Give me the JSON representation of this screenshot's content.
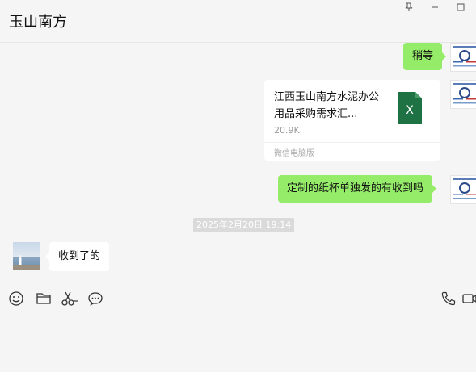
{
  "header": {
    "title": "玉山南方",
    "pin_icon": "pin-icon",
    "minimize_icon": "minimize-icon",
    "maximize_icon": "maximize-icon"
  },
  "messages": {
    "msg1": {
      "text": "稍等",
      "side": "right"
    },
    "file": {
      "name": "江西玉山南方水泥办公用品采购需求汇...",
      "size": "20.9K",
      "source": "微信电脑版",
      "icon": "excel-file-icon",
      "icon_letter": "X"
    },
    "msg3": {
      "text": "定制的纸杯单独发的有收到吗",
      "side": "right"
    },
    "timestamp": "2025年2月20日 19:14",
    "msg4": {
      "text": "收到了的",
      "side": "left"
    }
  },
  "toolbar": {
    "emoji_icon": "emoji-icon",
    "folder_icon": "folder-icon",
    "scissors_icon": "scissors-icon",
    "chat_history_icon": "chat-bubble-icon",
    "voice_call_icon": "phone-icon",
    "video_call_icon": "video-icon"
  },
  "input": {
    "value": "",
    "placeholder": ""
  },
  "colors": {
    "background": "#f5f5f5",
    "sent_bubble": "#95ec69",
    "received_bubble": "#ffffff",
    "excel_green": "#1f7244",
    "timestamp_bg": "#dadada"
  }
}
